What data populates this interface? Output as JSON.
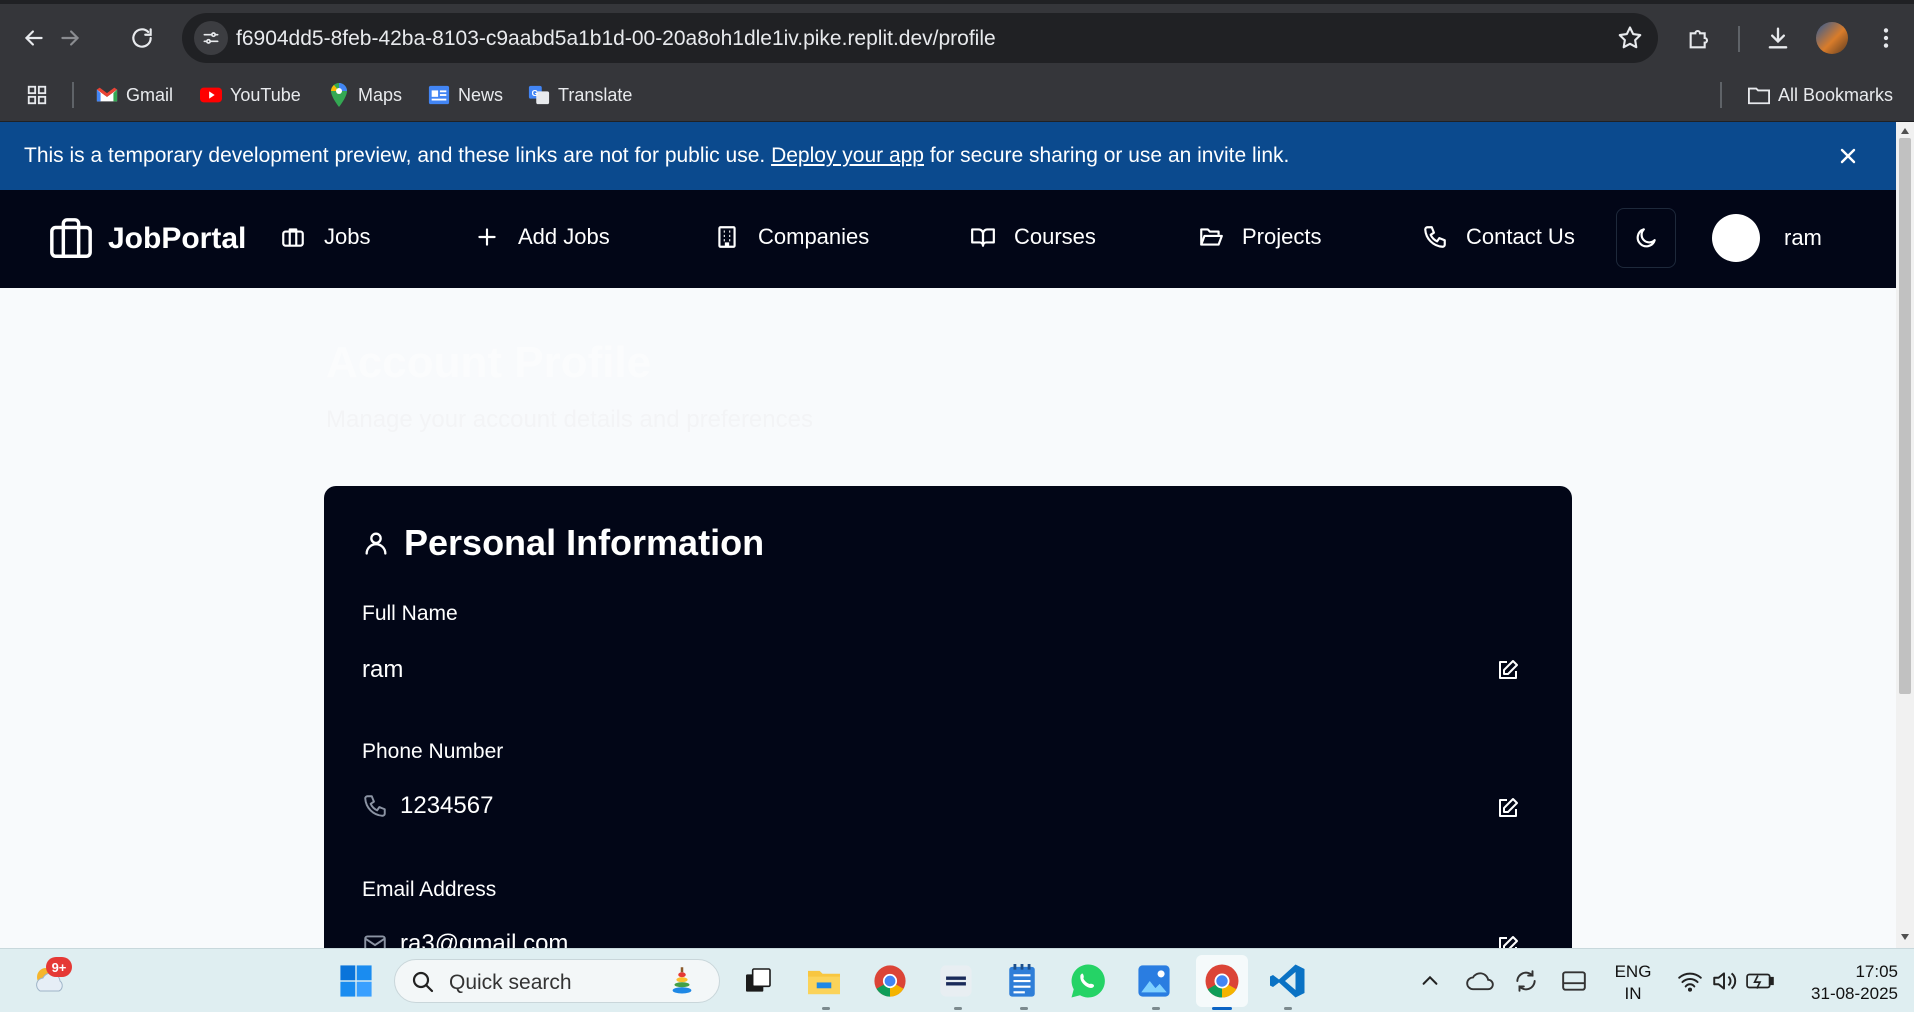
{
  "browser": {
    "url": "f6904dd5-8feb-42ba-8103-c9aabd5a1b1d-00-20a8oh1dle1iv.pike.replit.dev/profile",
    "bookmarks": [
      {
        "label": "Gmail",
        "icon": "gmail-icon"
      },
      {
        "label": "YouTube",
        "icon": "youtube-icon"
      },
      {
        "label": "Maps",
        "icon": "maps-icon"
      },
      {
        "label": "News",
        "icon": "news-icon"
      },
      {
        "label": "Translate",
        "icon": "translate-icon"
      }
    ],
    "all_bookmarks": "All Bookmarks"
  },
  "banner": {
    "text_before": "This is a temporary development preview, and these links are not for public use. ",
    "link": "Deploy your app",
    "text_after": " for secure sharing or use an invite link."
  },
  "nav": {
    "brand": "JobPortal",
    "links": [
      {
        "label": "Jobs",
        "icon": "briefcase-icon"
      },
      {
        "label": "Add Jobs",
        "icon": "plus-icon"
      },
      {
        "label": "Companies",
        "icon": "building-icon"
      },
      {
        "label": "Courses",
        "icon": "book-open-icon"
      },
      {
        "label": "Projects",
        "icon": "folder-open-icon"
      },
      {
        "label": "Contact Us",
        "icon": "phone-icon"
      }
    ],
    "user": "ram"
  },
  "page": {
    "title": "Account Profile",
    "subtitle": "Manage your account details and preferences"
  },
  "card": {
    "title": "Personal Information",
    "fields": [
      {
        "label": "Full Name",
        "value": "ram"
      },
      {
        "label": "Phone Number",
        "value": "1234567"
      },
      {
        "label": "Email Address",
        "value": "ra3@gmail.com"
      }
    ]
  },
  "taskbar": {
    "weather_badge": "9+",
    "search_placeholder": "Quick search",
    "lang_top": "ENG",
    "lang_bottom": "IN",
    "time": "17:05",
    "date": "31-08-2025"
  },
  "colors": {
    "banner": "#0b4a8e",
    "navbar": "#020617",
    "card": "#020617",
    "page_bg": "#f8fafc"
  }
}
